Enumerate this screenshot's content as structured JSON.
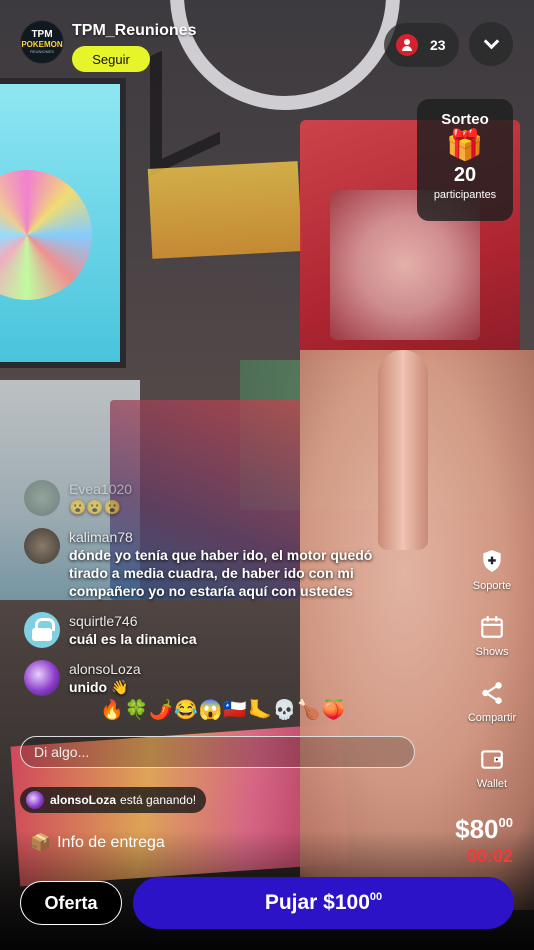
{
  "host": {
    "name": "TPM_Reuniones",
    "avatar_text": [
      "TPM",
      "POKEMON",
      "REUNIONES"
    ],
    "follow_label": "Seguir"
  },
  "viewers": {
    "count": "23",
    "icon": "person-icon"
  },
  "giveaway": {
    "title": "Sorteo",
    "icon": "gift-icon",
    "count": "20",
    "label": "participantes"
  },
  "side_actions": [
    {
      "label": "Soporte",
      "icon": "shield-plus-icon"
    },
    {
      "label": "Shows",
      "icon": "calendar-icon"
    },
    {
      "label": "Compartir",
      "icon": "share-icon"
    },
    {
      "label": "Wallet",
      "icon": "wallet-icon"
    }
  ],
  "chat": {
    "messages": [
      {
        "user": "Evea1020",
        "text": "😮😮😮"
      },
      {
        "user": "kaliman78",
        "text": "dónde yo tenía que haber ido, el motor quedó tirado a media cuadra, de haber ido con mi compañero yo no estaría aquí con ustedes"
      },
      {
        "user": "squirtle746",
        "text": "cuál es la dinamica"
      },
      {
        "user": "alonsoLoza",
        "text": "unido 👋"
      }
    ],
    "emoji_reactions": "🔥🍀🌶️😂😱🇨🇱🦶💀🍗🍑",
    "input_placeholder": "Di algo..."
  },
  "winning": {
    "user": "alonsoLoza",
    "text": "está ganando!"
  },
  "delivery": {
    "icon": "package-icon",
    "label": "Info de entrega"
  },
  "auction": {
    "price_main": "$80",
    "price_cents": "00",
    "timer": "00:02",
    "timer_color": "#f03c3c"
  },
  "actions": {
    "offer_label": "Oferta",
    "bid_main": "Pujar $100",
    "bid_cents": "00",
    "bid_color": "#2c13c7",
    "follow_color": "#e5f52a"
  }
}
